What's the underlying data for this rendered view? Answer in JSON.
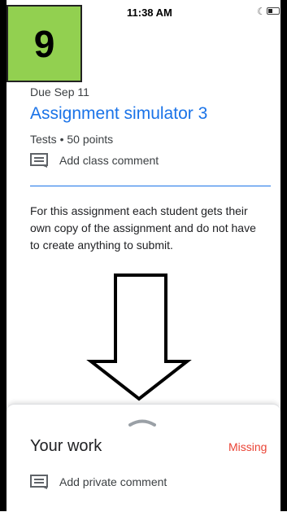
{
  "status_bar": {
    "time": "11:38 AM",
    "icons": [
      "moon-icon",
      "battery-icon"
    ]
  },
  "overlay": {
    "step_number": "9",
    "step_color": "#92d050",
    "arrow_icon": "down-arrow-icon"
  },
  "assignment": {
    "due": "Due Sep 11",
    "title": "Assignment simulator 3",
    "meta": "Tests • 50 points",
    "class_comment_label": "Add class comment",
    "description": "For this assignment each student gets their own copy of the assignment and do not have to create anything to submit.",
    "accent_color": "#1a73e8"
  },
  "your_work": {
    "title": "Your work",
    "status": "Missing",
    "status_color": "#ea4335",
    "private_comment_label": "Add private comment"
  }
}
